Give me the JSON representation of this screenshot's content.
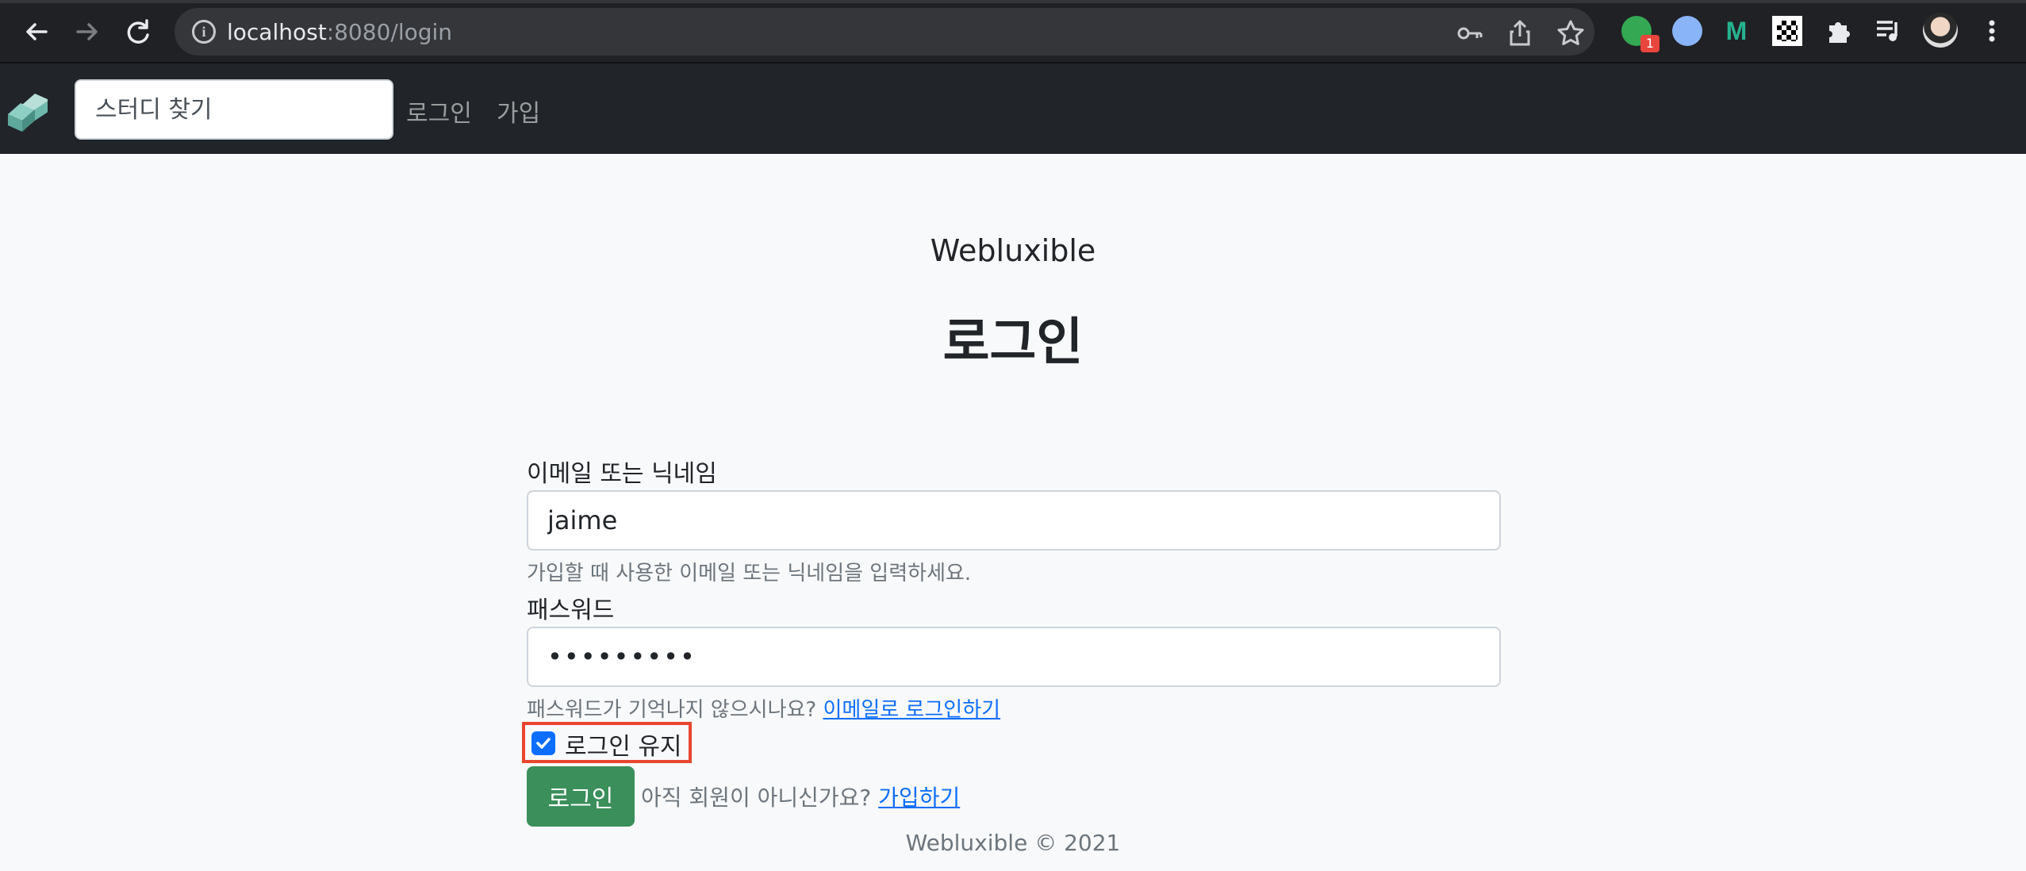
{
  "browser": {
    "back_icon": "arrow-left-icon",
    "forward_icon": "arrow-right-icon",
    "reload_icon": "reload-icon",
    "url_host": "localhost",
    "url_rest": ":8080/login",
    "extension_badge": "1"
  },
  "navbar": {
    "search_placeholder": "스터디 찾기",
    "login_link": "로그인",
    "signup_link": "가입"
  },
  "main": {
    "brand": "Webluxible",
    "title": "로그인",
    "username_label": "이메일 또는 닉네임",
    "username_value": "jaime",
    "username_help": "가입할 때 사용한 이메일 또는 닉네임을 입력하세요.",
    "password_label": "패스워드",
    "password_value": "•••••••••",
    "password_help": "패스워드가 기억나지 않으시나요?",
    "email_login_link": "이메일로 로그인하기",
    "remember_label": "로그인 유지",
    "remember_checked": true,
    "login_button": "로그인",
    "signup_prompt": "아직 회원이 아니신가요?",
    "signup_link": "가입하기"
  },
  "footer": {
    "text": "Webluxible © 2021"
  },
  "colors": {
    "primary": "#0d6efd",
    "success": "#3a8f5a",
    "navbar": "#212529",
    "highlight": "#e8462f"
  }
}
